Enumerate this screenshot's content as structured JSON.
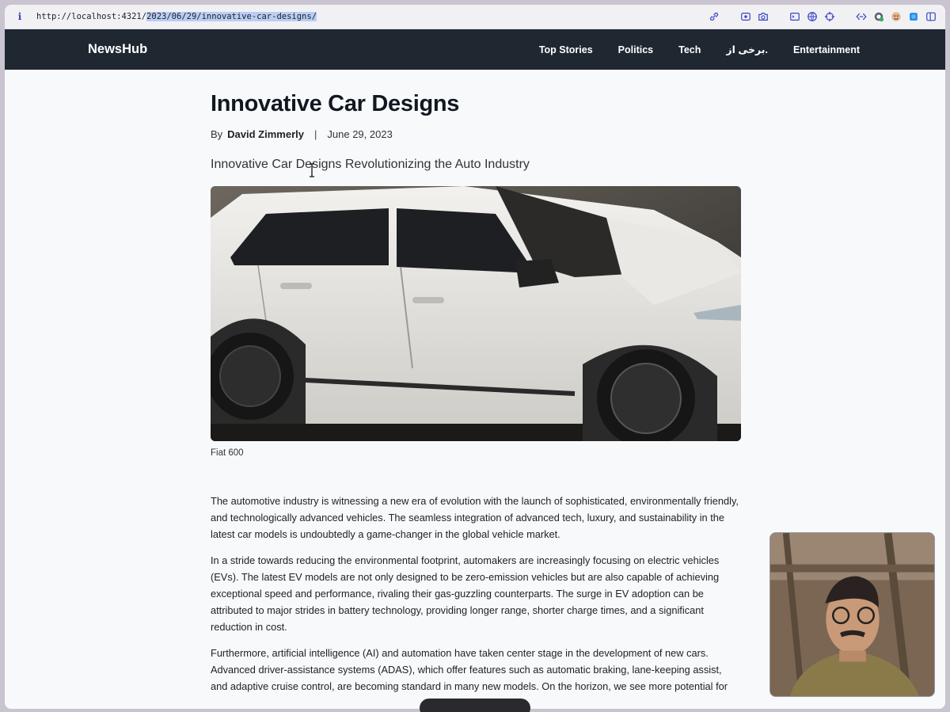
{
  "browser": {
    "url_prefix": "http://localhost:4321/",
    "url_path": "2023/06/29/innovative-car-designs/",
    "icons": [
      "link-icon",
      "screenshot-icon",
      "camera-icon",
      "terminal-icon",
      "globe-icon",
      "crosshair-icon",
      "code-icon",
      "extension-icon",
      "avatar-icon",
      "window-icon",
      "sidebar-icon"
    ]
  },
  "site": {
    "brand": "NewsHub",
    "nav": [
      "Top Stories",
      "Politics",
      "Tech",
      "برخی از.",
      "Entertainment"
    ]
  },
  "article": {
    "title": "Innovative Car Designs",
    "by_label": "By",
    "author": "David Zimmerly",
    "separator": "|",
    "date": "June 29, 2023",
    "subtitle": "Innovative Car Designs Revolutionizing the Auto Industry",
    "image_caption": "Fiat 600",
    "paragraphs": [
      "The automotive industry is witnessing a new era of evolution with the launch of sophisticated, environmentally friendly, and technologically advanced vehicles. The seamless integration of advanced tech, luxury, and sustainability in the latest car models is undoubtedly a game-changer in the global vehicle market.",
      "In a stride towards reducing the environmental footprint, automakers are increasingly focusing on electric vehicles (EVs). The latest EV models are not only designed to be zero-emission vehicles but are also capable of achieving exceptional speed and performance, rivaling their gas-guzzling counterparts. The surge in EV adoption can be attributed to major strides in battery technology, providing longer range, shorter charge times, and a significant reduction in cost.",
      "Furthermore, artificial intelligence (AI) and automation have taken center stage in the development of new cars. Advanced driver-assistance systems (ADAS), which offer features such as automatic braking, lane-keeping assist, and adaptive cruise control, are becoming standard in many new models. On the horizon, we see more potential for"
    ]
  }
}
